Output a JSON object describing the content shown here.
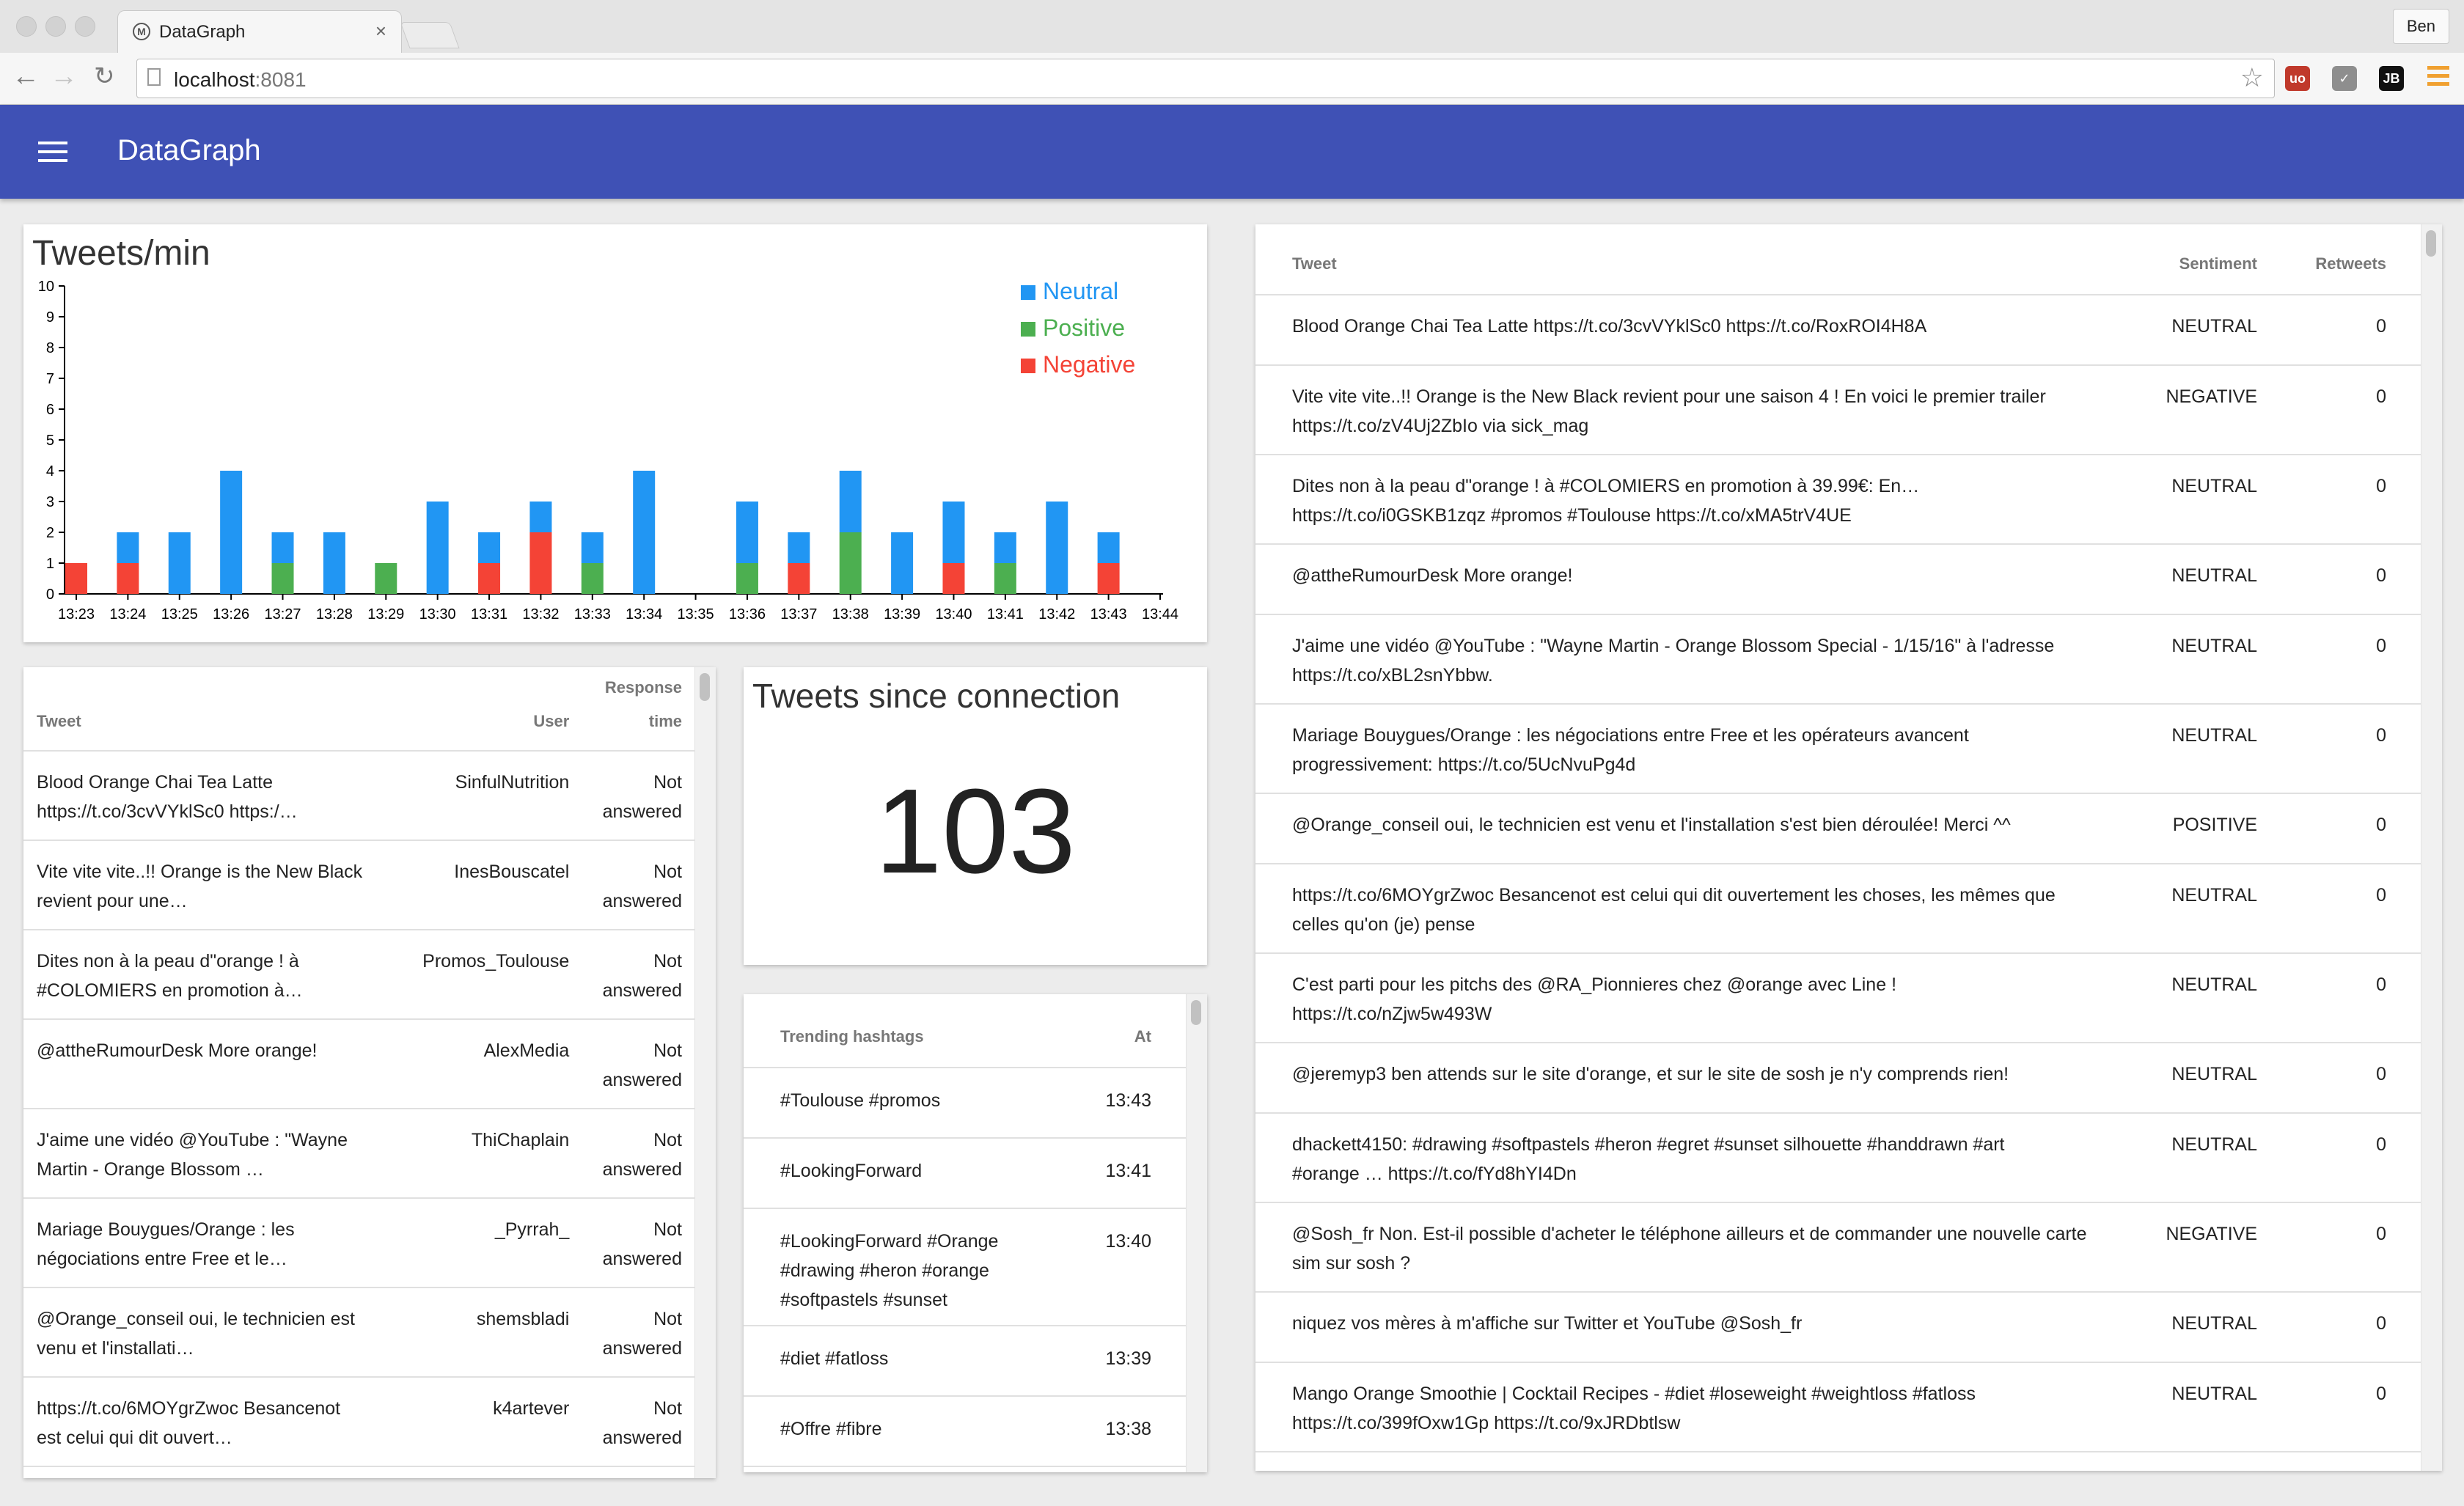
{
  "browser": {
    "tab_title": "DataGraph",
    "tab_close": "×",
    "profile": "Ben",
    "url_host": "localhost",
    "url_port": ":8081",
    "extensions": [
      {
        "icon": "ublock-icon",
        "color": "#c0392b",
        "text": "uo"
      },
      {
        "icon": "pocket-icon",
        "color": "#8e8e8e",
        "text": "✓"
      },
      {
        "icon": "jetbrains-icon",
        "color": "#111111",
        "text": "JB"
      }
    ]
  },
  "app": {
    "title": "DataGraph"
  },
  "chart": {
    "title": "Tweets/min",
    "chart_data": {
      "type": "bar",
      "stacked": true,
      "categories": [
        "13:23",
        "13:24",
        "13:25",
        "13:26",
        "13:27",
        "13:28",
        "13:29",
        "13:30",
        "13:31",
        "13:32",
        "13:33",
        "13:34",
        "13:35",
        "13:36",
        "13:37",
        "13:38",
        "13:39",
        "13:40",
        "13:41",
        "13:42",
        "13:43",
        "13:44"
      ],
      "series": [
        {
          "name": "Negative",
          "color": "#f44336",
          "values": [
            1,
            1,
            0,
            0,
            0,
            0,
            0,
            0,
            1,
            2,
            0,
            0,
            0,
            0,
            1,
            0,
            0,
            1,
            0,
            0,
            1,
            0
          ]
        },
        {
          "name": "Positive",
          "color": "#4caf50",
          "values": [
            0,
            0,
            0,
            0,
            1,
            0,
            1,
            0,
            0,
            0,
            1,
            0,
            0,
            1,
            0,
            2,
            0,
            0,
            1,
            0,
            0,
            0
          ]
        },
        {
          "name": "Neutral",
          "color": "#2196f3",
          "values": [
            0,
            1,
            2,
            4,
            1,
            2,
            0,
            3,
            1,
            1,
            1,
            4,
            0,
            2,
            1,
            2,
            2,
            2,
            1,
            3,
            1,
            0
          ]
        }
      ],
      "legend_order": [
        "Neutral",
        "Positive",
        "Negative"
      ],
      "ylim": [
        0,
        10
      ],
      "yticks": [
        "0",
        "1",
        "2",
        "3",
        "4",
        "5",
        "6",
        "7",
        "8",
        "9",
        "10"
      ],
      "legend": "top-right",
      "grid": false
    }
  },
  "response_table": {
    "headers": {
      "tweet": "Tweet",
      "user": "User",
      "response_1": "Response",
      "response_2": "time"
    },
    "rows": [
      {
        "tweet_1": "Blood Orange Chai Tea Latte",
        "tweet_2": "https://t.co/3cvVYklSc0 https:/…",
        "user": "SinfulNutrition",
        "resp_1": "Not",
        "resp_2": "answered"
      },
      {
        "tweet_1": "Vite vite vite..!! Orange is the New Black",
        "tweet_2": "revient pour une…",
        "user": "InesBouscatel",
        "resp_1": "Not",
        "resp_2": "answered"
      },
      {
        "tweet_1": "Dites non à la peau d\"orange ! à",
        "tweet_2": "#COLOMIERS en promotion à…",
        "user": "Promos_Toulouse",
        "resp_1": "Not",
        "resp_2": "answered"
      },
      {
        "tweet_1": "@attheRumourDesk More orange!",
        "tweet_2": "",
        "user": "AlexMedia",
        "resp_1": "Not",
        "resp_2": "answered"
      },
      {
        "tweet_1": "J'aime une vidéo @YouTube : \"Wayne",
        "tweet_2": "Martin - Orange Blossom …",
        "user": "ThiChaplain",
        "resp_1": "Not",
        "resp_2": "answered"
      },
      {
        "tweet_1": "Mariage Bouygues/Orange : les",
        "tweet_2": "négociations entre Free et le…",
        "user": "_Pyrrah_",
        "resp_1": "Not",
        "resp_2": "answered"
      },
      {
        "tweet_1": "@Orange_conseil oui, le technicien est",
        "tweet_2": "venu et l'installati…",
        "user": "shemsbladi",
        "resp_1": "Not",
        "resp_2": "answered"
      },
      {
        "tweet_1": "https://t.co/6MOYgrZwoc Besancenot",
        "tweet_2": "est celui qui dit ouvert…",
        "user": "k4artever",
        "resp_1": "Not",
        "resp_2": "answered"
      }
    ]
  },
  "connection": {
    "title": "Tweets since connection",
    "count": "103"
  },
  "hashtags": {
    "headers": {
      "tag": "Trending hashtags",
      "at": "At"
    },
    "rows": [
      {
        "tags": [
          "#Toulouse #promos"
        ],
        "at": "13:43"
      },
      {
        "tags": [
          "#LookingForward"
        ],
        "at": "13:41"
      },
      {
        "tags": [
          "#LookingForward #Orange",
          "#drawing #heron #orange",
          "#softpastels #sunset"
        ],
        "at": "13:40"
      },
      {
        "tags": [
          "#diet #fatloss"
        ],
        "at": "13:39"
      },
      {
        "tags": [
          "#Offre #fibre"
        ],
        "at": "13:38"
      }
    ]
  },
  "sentiment_table": {
    "headers": {
      "tweet": "Tweet",
      "sentiment": "Sentiment",
      "retweets": "Retweets"
    },
    "rows": [
      {
        "lines": [
          "Blood Orange Chai Tea Latte https://t.co/3cvVYklSc0 https://t.co/RoxROI4H8A"
        ],
        "sentiment": "NEUTRAL",
        "retweets": "0"
      },
      {
        "lines": [
          "Vite vite vite..!! Orange is the New Black revient pour une saison 4 ! En voici le premier trailer",
          "https://t.co/zV4Uj2ZbIo via sick_mag"
        ],
        "sentiment": "NEGATIVE",
        "retweets": "0"
      },
      {
        "lines": [
          "Dites non à la peau d\"orange ! à #COLOMIERS en promotion à 39.99€: En…",
          "https://t.co/i0GSKB1zqz #promos #Toulouse https://t.co/xMA5trV4UE"
        ],
        "sentiment": "NEUTRAL",
        "retweets": "0"
      },
      {
        "lines": [
          "@attheRumourDesk More orange!"
        ],
        "sentiment": "NEUTRAL",
        "retweets": "0"
      },
      {
        "lines": [
          "J'aime une vidéo @YouTube : \"Wayne Martin - Orange Blossom Special - 1/15/16\" à l'adresse",
          "https://t.co/xBL2snYbbw."
        ],
        "sentiment": "NEUTRAL",
        "retweets": "0"
      },
      {
        "lines": [
          "Mariage Bouygues/Orange : les négociations entre Free et les opérateurs avancent",
          "progressivement: https://t.co/5UcNvuPg4d"
        ],
        "sentiment": "NEUTRAL",
        "retweets": "0"
      },
      {
        "lines": [
          "@Orange_conseil oui, le technicien est venu et l'installation s'est bien déroulée! Merci ^^"
        ],
        "sentiment": "POSITIVE",
        "retweets": "0"
      },
      {
        "lines": [
          "https://t.co/6MOYgrZwoc Besancenot est celui qui dit ouvertement les choses, les mêmes que",
          "celles qu'on (je) pense"
        ],
        "sentiment": "NEUTRAL",
        "retweets": "0"
      },
      {
        "lines": [
          "C'est parti pour les pitchs des @RA_Pionnieres chez @orange avec Line !",
          "https://t.co/nZjw5w493W"
        ],
        "sentiment": "NEUTRAL",
        "retweets": "0"
      },
      {
        "lines": [
          "@jeremyp3 ben attends sur le site d'orange, et sur le site de sosh je n'y comprends rien!"
        ],
        "sentiment": "NEUTRAL",
        "retweets": "0"
      },
      {
        "lines": [
          "dhackett4150: #drawing #softpastels #heron #egret #sunset silhouette #handdrawn #art",
          "#orange … https://t.co/fYd8hYI4Dn"
        ],
        "sentiment": "NEUTRAL",
        "retweets": "0"
      },
      {
        "lines": [
          "@Sosh_fr Non. Est-il possible d'acheter le téléphone ailleurs et de commander une nouvelle carte",
          "sim sur sosh ?"
        ],
        "sentiment": "NEGATIVE",
        "retweets": "0"
      },
      {
        "lines": [
          "niquez vos mères à m'affiche sur Twitter et YouTube @Sosh_fr"
        ],
        "sentiment": "NEUTRAL",
        "retweets": "0"
      },
      {
        "lines": [
          "Mango Orange Smoothie | Cocktail Recipes - #diet #loseweight #weightloss #fatloss",
          "https://t.co/399fOxw1Gp https://t.co/9xJRDbtlsw"
        ],
        "sentiment": "NEUTRAL",
        "retweets": "0"
      }
    ]
  }
}
